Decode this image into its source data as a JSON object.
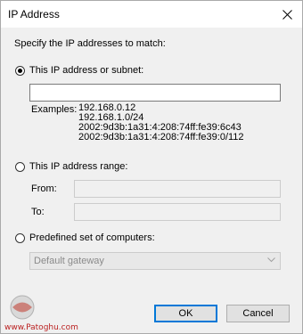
{
  "window": {
    "title": "IP Address"
  },
  "prompt": "Specify the IP addresses to match:",
  "option_subnet": {
    "label": "This IP address or subnet:",
    "checked": true,
    "value": "",
    "examples_label": "Examples:",
    "examples": [
      "192.168.0.12",
      "192.168.1.0/24",
      "2002:9d3b:1a31:4:208:74ff:fe39:6c43",
      "2002:9d3b:1a31:4:208:74ff:fe39:0/112"
    ]
  },
  "option_range": {
    "label": "This IP address range:",
    "checked": false,
    "from_label": "From:",
    "to_label": "To:",
    "from_value": "",
    "to_value": ""
  },
  "option_predefined": {
    "label": "Predefined set of computers:",
    "checked": false,
    "selected": "Default gateway"
  },
  "buttons": {
    "ok": "OK",
    "cancel": "Cancel"
  },
  "watermark": {
    "text": "www.Patoghu.com"
  },
  "icons": {
    "close": "close-icon",
    "dropdown": "chevron-down-icon"
  },
  "colors": {
    "focus_border": "#0078d7",
    "window_bg": "#f0f0f0"
  }
}
